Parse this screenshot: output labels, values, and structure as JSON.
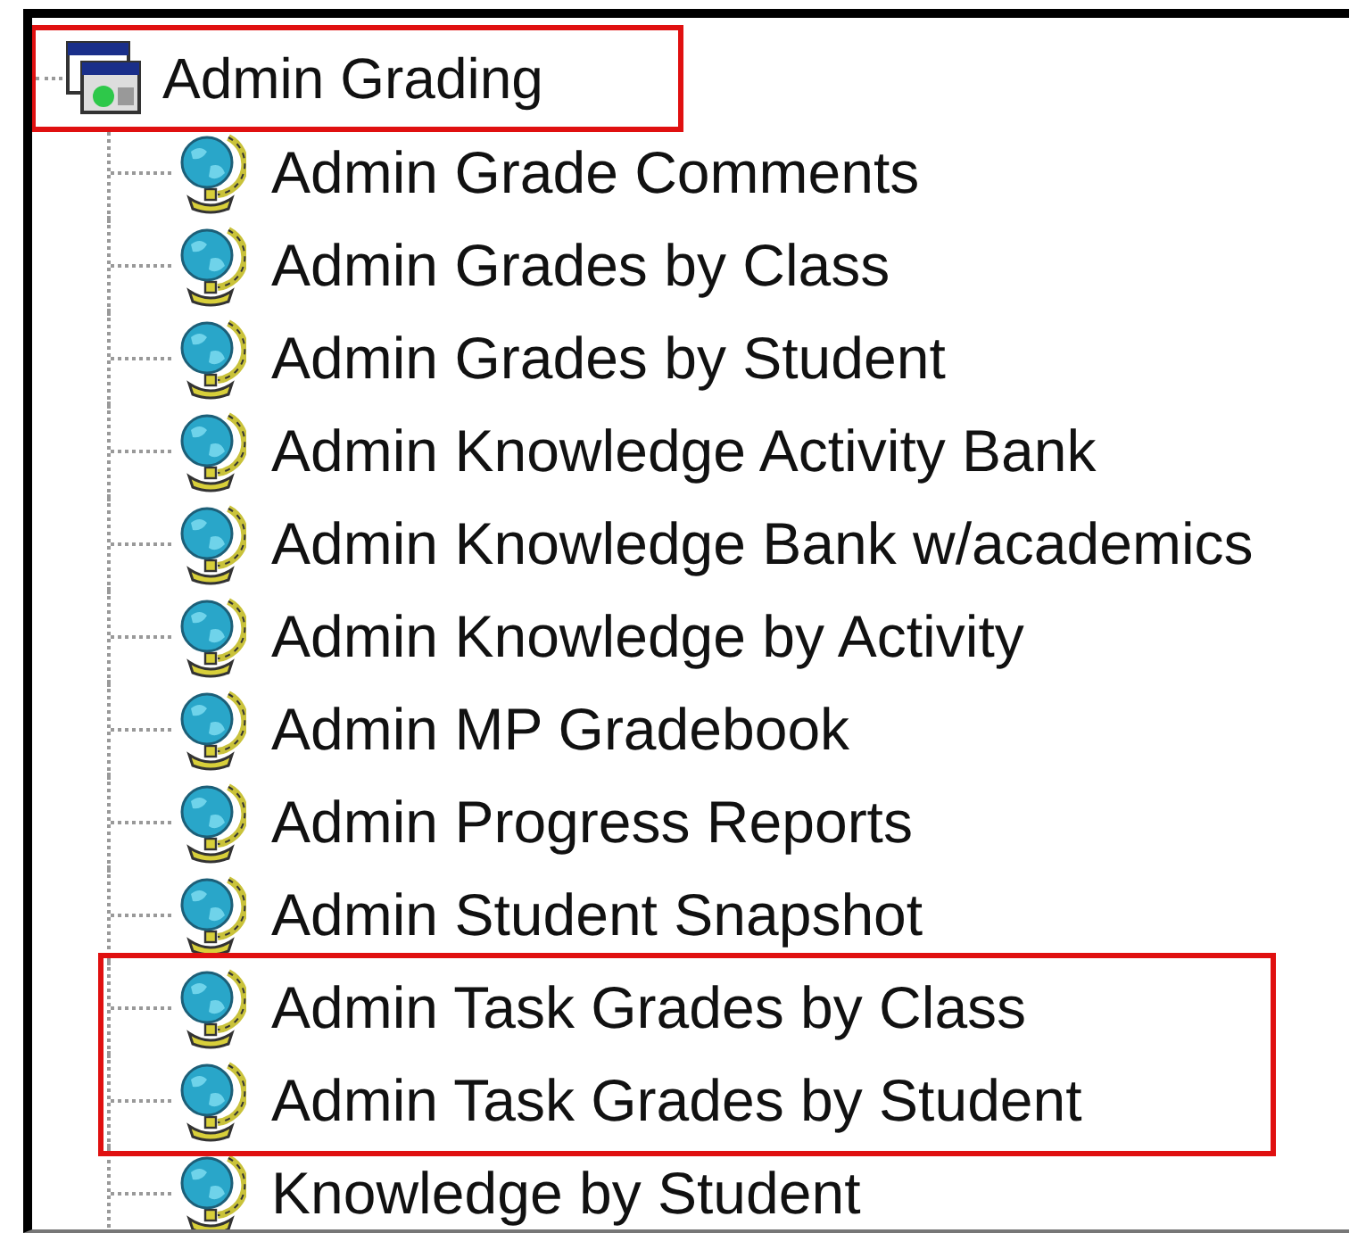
{
  "tree": {
    "label": "Admin Grading",
    "highlighted": true,
    "children": [
      {
        "label": "Admin Grade Comments",
        "highlighted": false
      },
      {
        "label": "Admin Grades by Class",
        "highlighted": false
      },
      {
        "label": "Admin Grades by Student",
        "highlighted": false
      },
      {
        "label": "Admin Knowledge Activity Bank",
        "highlighted": false
      },
      {
        "label": "Admin Knowledge Bank w/academics",
        "highlighted": false
      },
      {
        "label": "Admin Knowledge by Activity",
        "highlighted": false
      },
      {
        "label": "Admin MP Gradebook",
        "highlighted": false
      },
      {
        "label": "Admin Progress Reports",
        "highlighted": false
      },
      {
        "label": "Admin Student Snapshot",
        "highlighted": false
      },
      {
        "label": "Admin Task Grades by Class",
        "highlighted": true
      },
      {
        "label": "Admin Task Grades by Student",
        "highlighted": true
      },
      {
        "label": "Knowledge by Student",
        "highlighted": false
      }
    ]
  }
}
